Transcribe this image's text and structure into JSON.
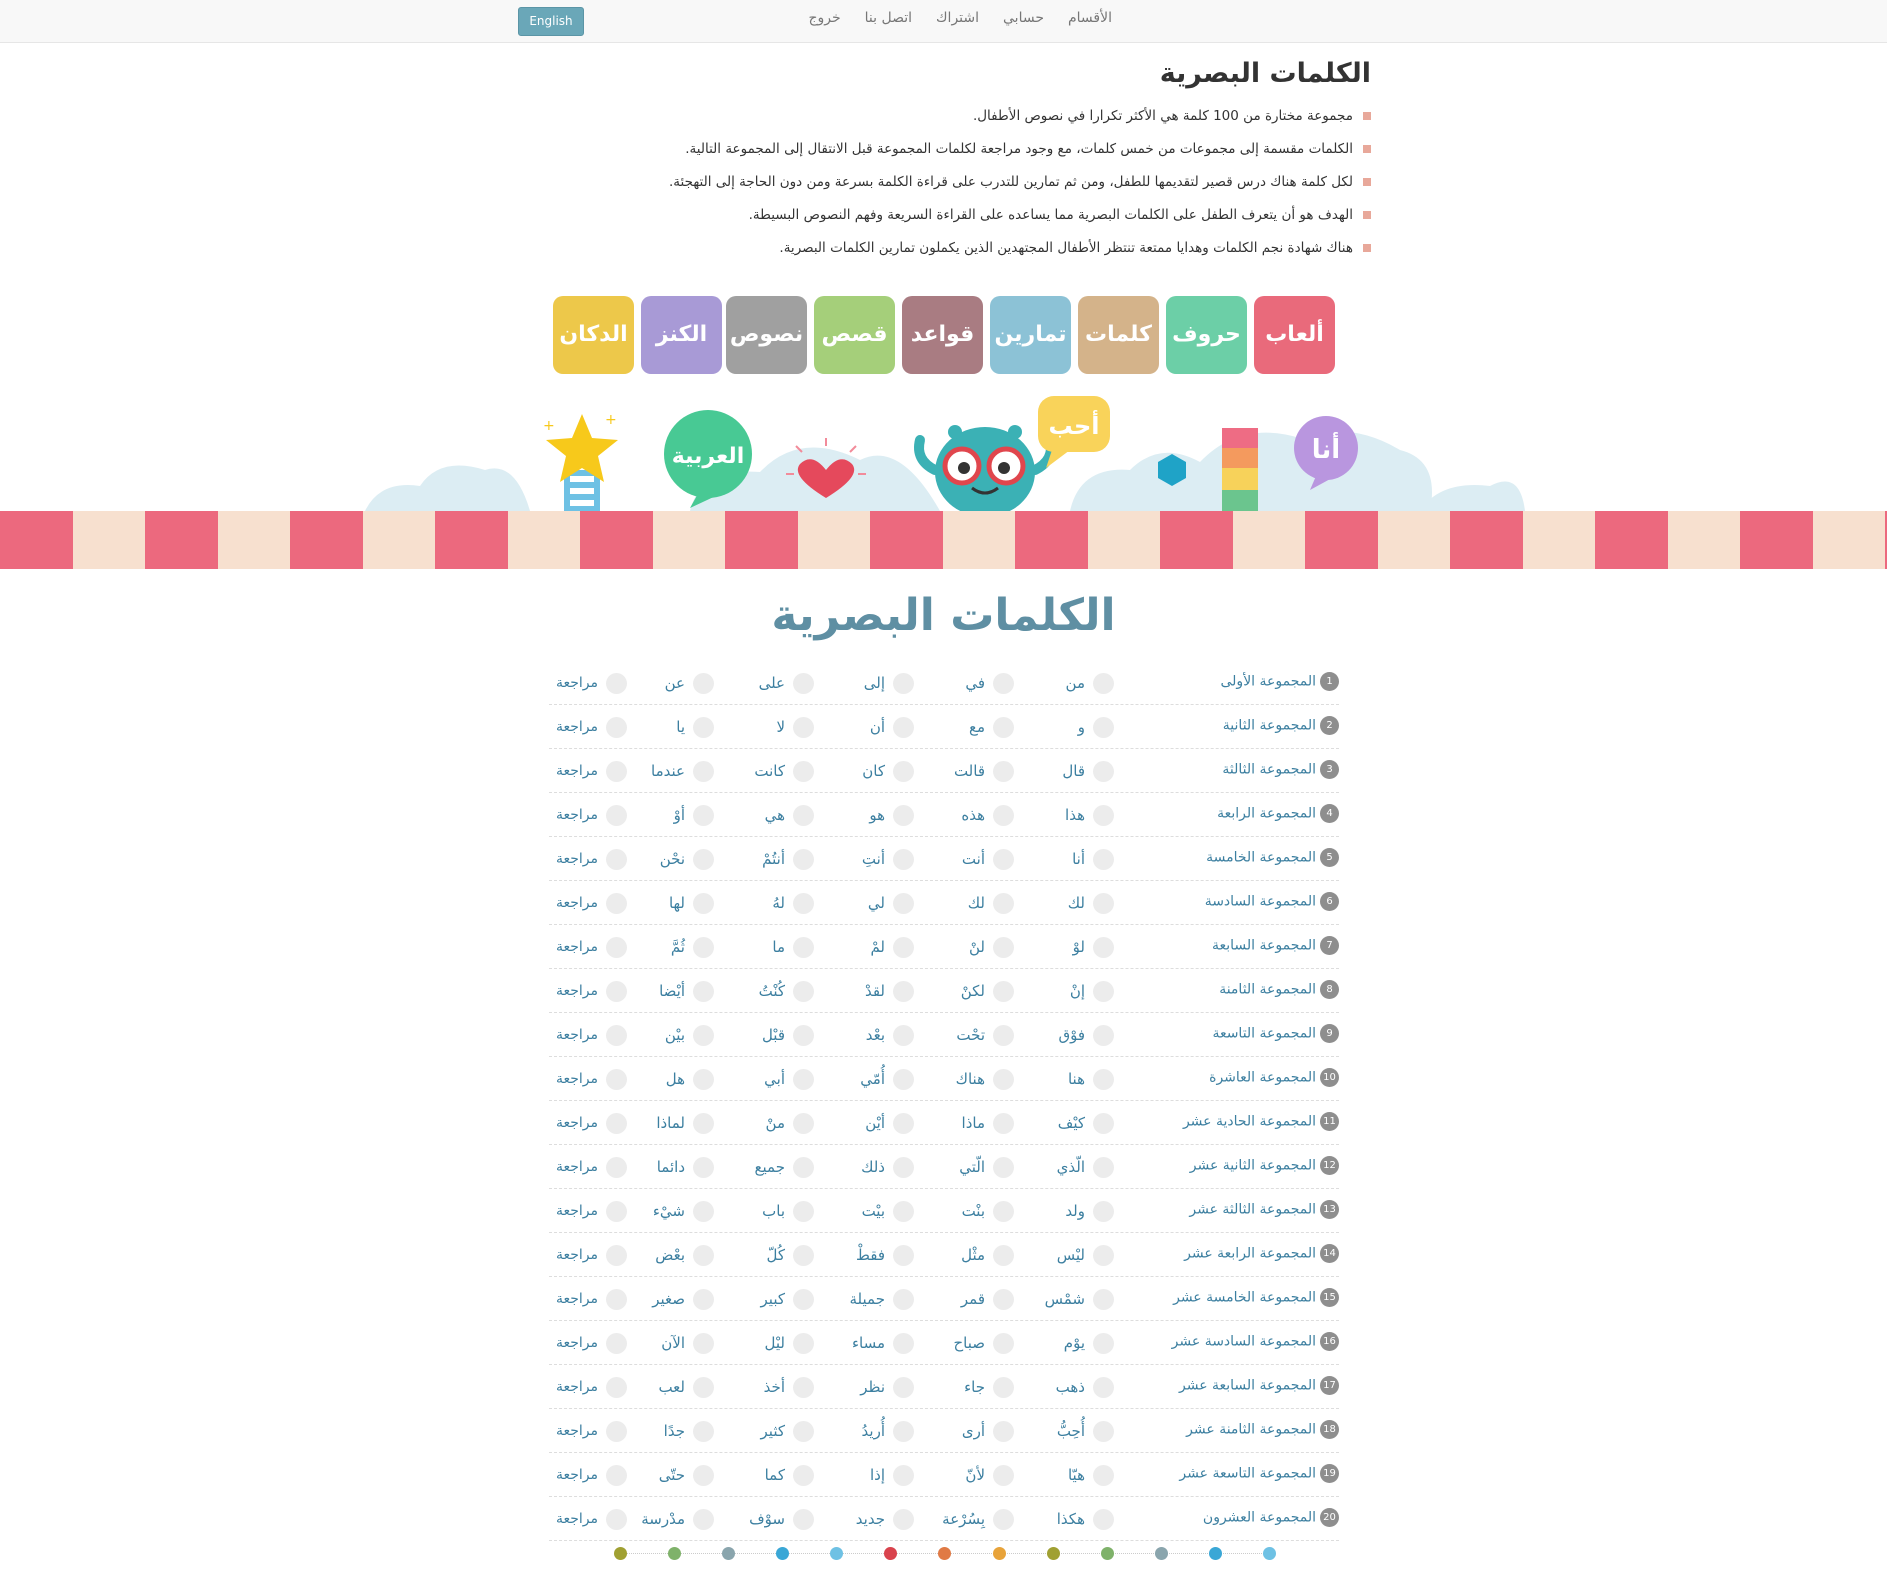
{
  "nav": {
    "items": [
      "الأقسام",
      "حسابي",
      "اشتراك",
      "اتصل بنا",
      "خروج"
    ],
    "lang": "English"
  },
  "intro": {
    "title": "الكلمات البصرية",
    "points": [
      "مجموعة مختارة من 100 كلمة هي الأكثر تكرارا في نصوص الأطفال.",
      "الكلمات مقسمة إلى مجموعات من خمس كلمات، مع وجود مراجعة لكلمات المجموعة قبل الانتقال إلى المجموعة التالية.",
      "لكل كلمة هناك درس قصير لتقديمها للطفل، ومن ثم تمارين للتدرب على قراءة الكلمة بسرعة ومن دون الحاجة إلى التهجئة.",
      "الهدف هو أن يتعرف الطفل على الكلمات البصرية مما يساعده على القراءة السريعة وفهم النصوص البسيطة.",
      "هناك شهادة نجم الكلمات وهدايا ممتعة تنتظر الأطفال المجتهدين الذين يكملون تمارين الكلمات البصرية."
    ]
  },
  "tiles": [
    {
      "label": "ألعاب",
      "color": "#e96a7b"
    },
    {
      "label": "حروف",
      "color": "#6ccfa7"
    },
    {
      "label": "كلمات",
      "color": "#d4b38a"
    },
    {
      "label": "تمارين",
      "color": "#8cc2d6"
    },
    {
      "label": "قواعد",
      "color": "#a97c82"
    },
    {
      "label": "قصص",
      "color": "#a5cf7a"
    },
    {
      "label": "نصوص",
      "color": "#a0a0a0"
    },
    {
      "label": "الكنز",
      "color": "#a89ad6"
    },
    {
      "label": "الدكان",
      "color": "#edc84a"
    }
  ],
  "banner": {
    "bubble_ana": "أنا",
    "bubble_ahib": "أحب",
    "bubble_arabic": "العربية"
  },
  "words_section": {
    "title": "الكلمات البصرية",
    "review_label": "مراجعة",
    "groups": [
      {
        "num": "1",
        "name": "المجموعة الأولى",
        "words": [
          "من",
          "في",
          "إلى",
          "على",
          "عن"
        ]
      },
      {
        "num": "2",
        "name": "المجموعة الثانية",
        "words": [
          "و",
          "مع",
          "أن",
          "لا",
          "يا"
        ]
      },
      {
        "num": "3",
        "name": "المجموعة الثالثة",
        "words": [
          "قال",
          "قالت",
          "كان",
          "كانت",
          "عندما"
        ]
      },
      {
        "num": "4",
        "name": "المجموعة الرابعة",
        "words": [
          "هذا",
          "هذه",
          "هو",
          "هي",
          "أوْ"
        ]
      },
      {
        "num": "5",
        "name": "المجموعة الخامسة",
        "words": [
          "أنا",
          "أنت",
          "أنتِ",
          "أنتُمْ",
          "نحْن"
        ]
      },
      {
        "num": "6",
        "name": "المجموعة السادسة",
        "words": [
          "لك",
          "لك",
          "لي",
          "لهُ",
          "لها"
        ]
      },
      {
        "num": "7",
        "name": "المجموعة السابعة",
        "words": [
          "لوْ",
          "لنْ",
          "لمْ",
          "ما",
          "ثُمَّ"
        ]
      },
      {
        "num": "8",
        "name": "المجموعة الثامنة",
        "words": [
          "إنْ",
          "لكنْ",
          "لقدْ",
          "كُنْتُ",
          "أيْضا"
        ]
      },
      {
        "num": "9",
        "name": "المجموعة التاسعة",
        "words": [
          "فوْق",
          "تحْت",
          "بعْد",
          "قبْل",
          "بيْن"
        ]
      },
      {
        "num": "10",
        "name": "المجموعة العاشرة",
        "words": [
          "هنا",
          "هناك",
          "أُمّي",
          "أبي",
          "هل"
        ]
      },
      {
        "num": "11",
        "name": "المجموعة الحادية عشر",
        "words": [
          "كيْف",
          "ماذا",
          "أيْن",
          "منْ",
          "لماذا"
        ]
      },
      {
        "num": "12",
        "name": "المجموعة الثانية عشر",
        "words": [
          "الّذي",
          "الّتي",
          "ذلك",
          "جميع",
          "دائما"
        ]
      },
      {
        "num": "13",
        "name": "المجموعة الثالثة عشر",
        "words": [
          "ولد",
          "بنْت",
          "بيْت",
          "باب",
          "شيْء"
        ]
      },
      {
        "num": "14",
        "name": "المجموعة الرابعة عشر",
        "words": [
          "ليْس",
          "مثْل",
          "فقطْ",
          "كُلّ",
          "بعْض"
        ]
      },
      {
        "num": "15",
        "name": "المجموعة الخامسة عشر",
        "words": [
          "شمْس",
          "قمر",
          "جميلة",
          "كبير",
          "صغير"
        ]
      },
      {
        "num": "16",
        "name": "المجموعة السادسة عشر",
        "words": [
          "يوْم",
          "صباح",
          "مساء",
          "ليْل",
          "الآن"
        ]
      },
      {
        "num": "17",
        "name": "المجموعة السابعة عشر",
        "words": [
          "ذهب",
          "جاء",
          "نظر",
          "أخذ",
          "لعب"
        ]
      },
      {
        "num": "18",
        "name": "المجموعة الثامنة عشر",
        "words": [
          "أُحِبُّ",
          "أرى",
          "أُريدُ",
          "كثير",
          "جدًا"
        ]
      },
      {
        "num": "19",
        "name": "المجموعة التاسعة عشر",
        "words": [
          "هيّا",
          "لأنّ",
          "إذا",
          "كما",
          "حتّى"
        ]
      },
      {
        "num": "20",
        "name": "المجموعة العشرون",
        "words": [
          "هكذا",
          "بِسُرْعة",
          "جديد",
          "سوْف",
          "مدْرسة"
        ]
      }
    ]
  },
  "dots": [
    "#6ec1e4",
    "#3aa7d6",
    "#8aa5ad",
    "#7fb26a",
    "#a0a032",
    "#e8a33a",
    "#e07a45",
    "#d9434d",
    "#6ec1e4",
    "#3aa7d6",
    "#8aa5ad",
    "#7fb26a",
    "#a0a032"
  ],
  "colors": {
    "stripe_pink": "#ec697e",
    "stripe_cream": "#f7e0cf",
    "link_blue": "#3c7fa0",
    "title_blue": "#5f8fa3"
  }
}
